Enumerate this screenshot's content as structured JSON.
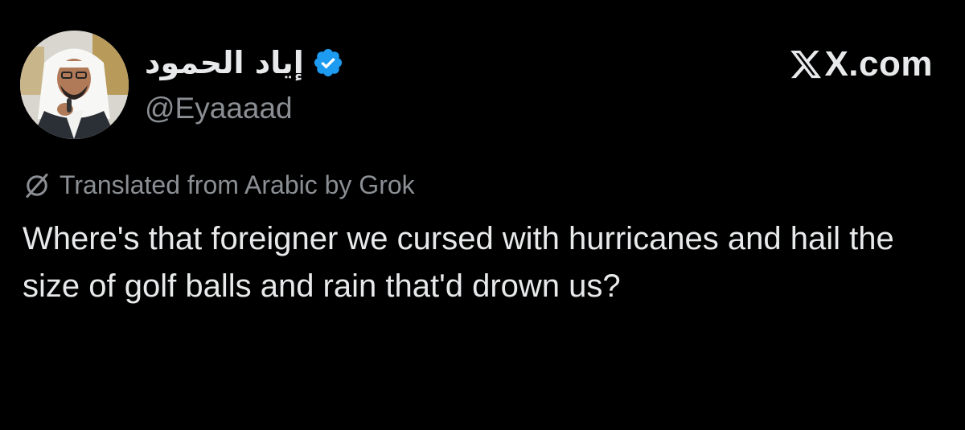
{
  "tweet": {
    "display_name": "إياد الحمود",
    "handle": "@Eyaaaad",
    "site_label": "X.com",
    "translation_note": "Translated from Arabic by Grok",
    "text": "Where's that foreigner we cursed with hurricanes and hail the size of golf balls and rain that'd drown us?"
  },
  "colors": {
    "background": "#000000",
    "text": "#e7e9ea",
    "secondary": "#8b8f94",
    "verified_blue": "#1d9bf0"
  },
  "icons": {
    "verified": "verified-badge-icon",
    "x_logo": "x-logo-icon",
    "translate": "translate-off-icon"
  }
}
